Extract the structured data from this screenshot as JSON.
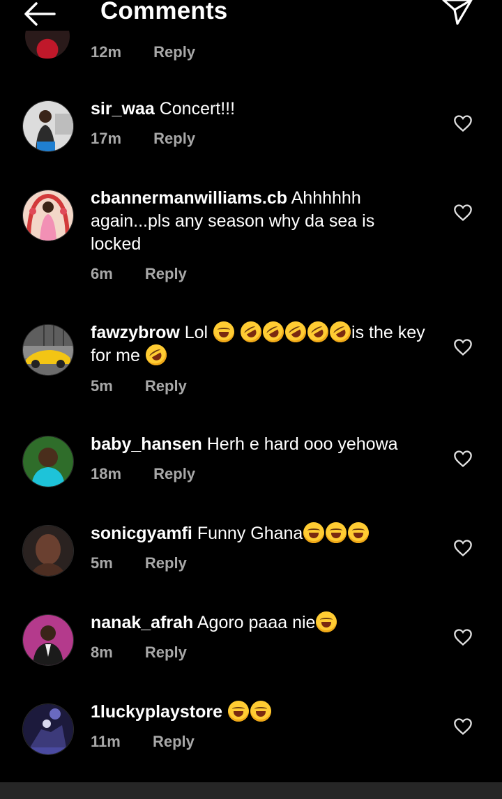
{
  "header": {
    "title": "Comments",
    "back_icon": "arrow-left-icon",
    "send_icon": "paper-plane-icon"
  },
  "partial_comment": {
    "time": "12m",
    "reply_label": "Reply"
  },
  "comments": [
    {
      "username": "sir_waa",
      "text": "Concert!!!",
      "time": "17m",
      "reply_label": "Reply",
      "emojis": []
    },
    {
      "username": "cbannermanwilliams.cb",
      "text": "Ahhhhhh again...pls any season why da sea is locked",
      "time": "6m",
      "reply_label": "Reply",
      "emojis": []
    },
    {
      "username": "fawzybrow",
      "text": "Lol",
      "text2": "is the key for me",
      "time": "5m",
      "reply_label": "Reply",
      "emojis": [
        "face-with-tears-of-joy",
        "rolling-on-floor-laughing",
        "rolling-on-floor-laughing",
        "rolling-on-floor-laughing",
        "rolling-on-floor-laughing",
        "rolling-on-floor-laughing",
        "rolling-on-floor-laughing"
      ]
    },
    {
      "username": "baby_hansen",
      "text": "Herh e hard ooo yehowa",
      "time": "18m",
      "reply_label": "Reply",
      "emojis": []
    },
    {
      "username": "sonicgyamfi",
      "text": "Funny Ghana",
      "time": "5m",
      "reply_label": "Reply",
      "emojis": [
        "face-with-tears-of-joy",
        "face-with-tears-of-joy",
        "face-with-tears-of-joy"
      ]
    },
    {
      "username": "nanak_afrah",
      "text": "Agoro paaa nie",
      "time": "8m",
      "reply_label": "Reply",
      "emojis": [
        "face-with-tears-of-joy"
      ]
    },
    {
      "username": "1luckyplaystore",
      "text": "",
      "time": "11m",
      "reply_label": "Reply",
      "emojis": [
        "face-with-tears-of-joy",
        "face-with-tears-of-joy"
      ]
    }
  ],
  "heart_icon": "heart-outline-icon",
  "colors": {
    "background": "#000000",
    "text": "#ffffff",
    "meta": "#a8a8a8",
    "bottom_bar": "#262626"
  }
}
